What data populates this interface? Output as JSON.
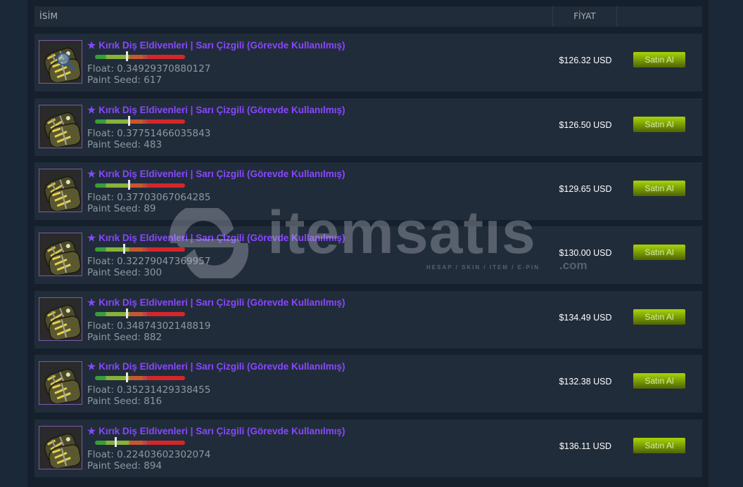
{
  "header": {
    "name_label": "İSİM",
    "price_label": "FİYAT"
  },
  "colors": {
    "item_name": "#8847ff",
    "buy_button": "#a4d007",
    "background": "#1b2838"
  },
  "listings": [
    {
      "name": "Kırık Diş Eldivenleri | Sarı Çizgili (Görevde Kullanılmış)",
      "star": "★",
      "float_label": "Float: 0.34929370880127",
      "float": 0.34929370880127,
      "seed_label": "Paint Seed: 617",
      "price": "$126.32 USD",
      "buy_label": "Satın Al",
      "icon": "glove-with-magnifier-icon"
    },
    {
      "name": "Kırık Diş Eldivenleri | Sarı Çizgili (Görevde Kullanılmış)",
      "star": "★",
      "float_label": "Float: 0.37751466035843",
      "float": 0.37751466035843,
      "seed_label": "Paint Seed: 483",
      "price": "$126.50 USD",
      "buy_label": "Satın Al",
      "icon": "glove-icon"
    },
    {
      "name": "Kırık Diş Eldivenleri | Sarı Çizgili (Görevde Kullanılmış)",
      "star": "★",
      "float_label": "Float: 0.37703067064285",
      "float": 0.37703067064285,
      "seed_label": "Paint Seed: 89",
      "price": "$129.65 USD",
      "buy_label": "Satın Al",
      "icon": "glove-icon"
    },
    {
      "name": "Kırık Diş Eldivenleri | Sarı Çizgili (Görevde Kullanılmış)",
      "star": "★",
      "float_label": "Float: 0.32279047369957",
      "float": 0.32279047369957,
      "seed_label": "Paint Seed: 300",
      "price": "$130.00 USD",
      "buy_label": "Satın Al",
      "icon": "glove-icon"
    },
    {
      "name": "Kırık Diş Eldivenleri | Sarı Çizgili (Görevde Kullanılmış)",
      "star": "★",
      "float_label": "Float: 0.34874302148819",
      "float": 0.34874302148819,
      "seed_label": "Paint Seed: 882",
      "price": "$134.49 USD",
      "buy_label": "Satın Al",
      "icon": "glove-icon"
    },
    {
      "name": "Kırık Diş Eldivenleri | Sarı Çizgili (Görevde Kullanılmış)",
      "star": "★",
      "float_label": "Float: 0.35231429338455",
      "float": 0.35231429338455,
      "seed_label": "Paint Seed: 816",
      "price": "$132.38 USD",
      "buy_label": "Satın Al",
      "icon": "glove-icon"
    },
    {
      "name": "Kırık Diş Eldivenleri | Sarı Çizgili (Görevde Kullanılmış)",
      "star": "★",
      "float_label": "Float: 0.22403602302074",
      "float": 0.22403602302074,
      "seed_label": "Paint Seed: 894",
      "price": "$136.11 USD",
      "buy_label": "Satın Al",
      "icon": "glove-icon"
    }
  ],
  "watermark": {
    "brand": "itemsatıs",
    "tagline": "HESAP / SKIN / ITEM / E-PIN",
    "domain": ".com"
  }
}
